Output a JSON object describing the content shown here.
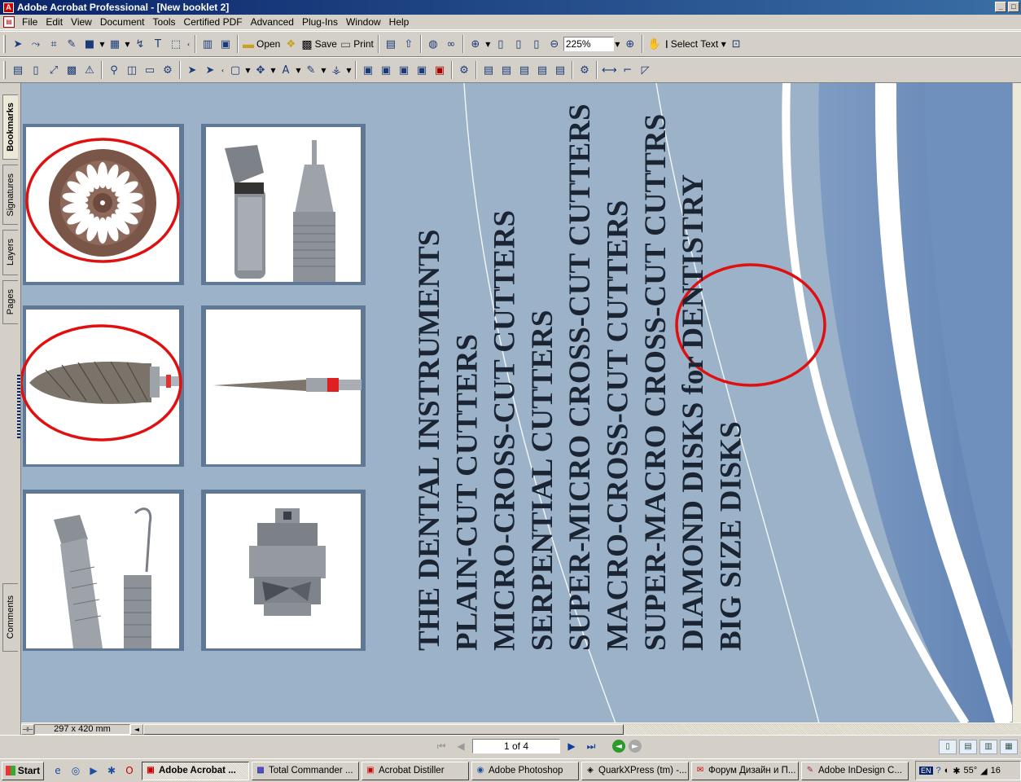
{
  "window": {
    "title": "Adobe Acrobat Professional - [New booklet 2]",
    "app_icon": "acrobat-icon"
  },
  "menu": [
    "File",
    "Edit",
    "View",
    "Document",
    "Tools",
    "Certified PDF",
    "Advanced",
    "Plug-Ins",
    "Window",
    "Help"
  ],
  "toolbar": {
    "open_label": "Open",
    "save_label": "Save",
    "print_label": "Print",
    "zoom_value": "225%",
    "select_text_label": "Select Text"
  },
  "nav_tabs": [
    "Bookmarks",
    "Signatures",
    "Layers",
    "Pages",
    "Comments"
  ],
  "document": {
    "lines": [
      "THE DENTAL INSTRUMENTS",
      "PLAIN-CUT CUTTERS",
      "MICRO-CROSS-CUT CUTTERS",
      "SERPENTIAL CUTTERS",
      "SUPER-MICRO CROSS-CUT CUTTERS",
      "MACRO-CROSS-CUT CUTTERS",
      "SUPER-MACRO CROSS-CUT CUTTRS",
      "DIAMOND DISKS for DENTISTRY",
      "BIG SIZE DISKS"
    ],
    "colors": {
      "page_bg": "#9bb2c9",
      "text": "#1a2433",
      "annotation": "#e01010",
      "frame": "#5e7896"
    },
    "images": [
      "cutting-disk-image",
      "handpiece-image",
      "cutter-bur-image",
      "needle-bur-image",
      "turbine-handpiece-image",
      "turbine-cartridge-image"
    ]
  },
  "hscroll": {
    "page_size": "297 x 420 mm"
  },
  "status": {
    "page_indicator": "1 of 4"
  },
  "taskbar": {
    "start_label": "Start",
    "buttons": [
      {
        "label": "Adobe Acrobat ...",
        "icon": "acrobat-icon"
      },
      {
        "label": "Total Commander ...",
        "icon": "floppy-icon"
      },
      {
        "label": "Acrobat Distiller",
        "icon": "distiller-icon"
      },
      {
        "label": "Adobe Photoshop",
        "icon": "photoshop-icon"
      },
      {
        "label": "QuarkXPress (tm) -...",
        "icon": "quark-icon"
      },
      {
        "label": "Форум Дизайн и П...",
        "icon": "browser-icon"
      },
      {
        "label": "Adobe InDesign C...",
        "icon": "indesign-icon"
      }
    ],
    "tray": {
      "lang": "EN",
      "temperature": "55°",
      "clock": "16"
    }
  }
}
